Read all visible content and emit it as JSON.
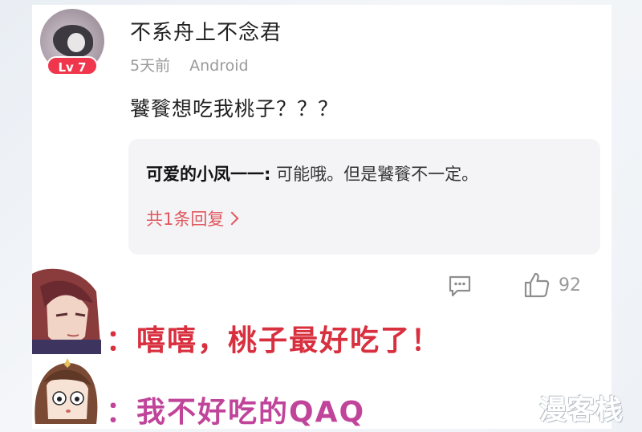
{
  "comment": {
    "username": "不系舟上不念君",
    "level": "Lv 7",
    "time": "5天前",
    "platform": "Android",
    "text": "饕餮想吃我桃子？？？",
    "reply": {
      "author": "可爱的小凤一一:",
      "text": " 可能哦。但是饕餮不一定。",
      "count_label": "共1条回复"
    },
    "actions": {
      "comment_icon": "comment-bubble-icon",
      "like_icon": "thumbs-up-icon",
      "like_count": "92"
    }
  },
  "comic": {
    "line1": "：嘻嘻，桃子最好吃了！",
    "line2": "：我不好吃的QAQ"
  },
  "watermark": "漫客栈",
  "colors": {
    "level_badge": "#f0364c",
    "reply_link": "#e0575e",
    "line1": "#d8303f",
    "line2": "#c0459a"
  }
}
